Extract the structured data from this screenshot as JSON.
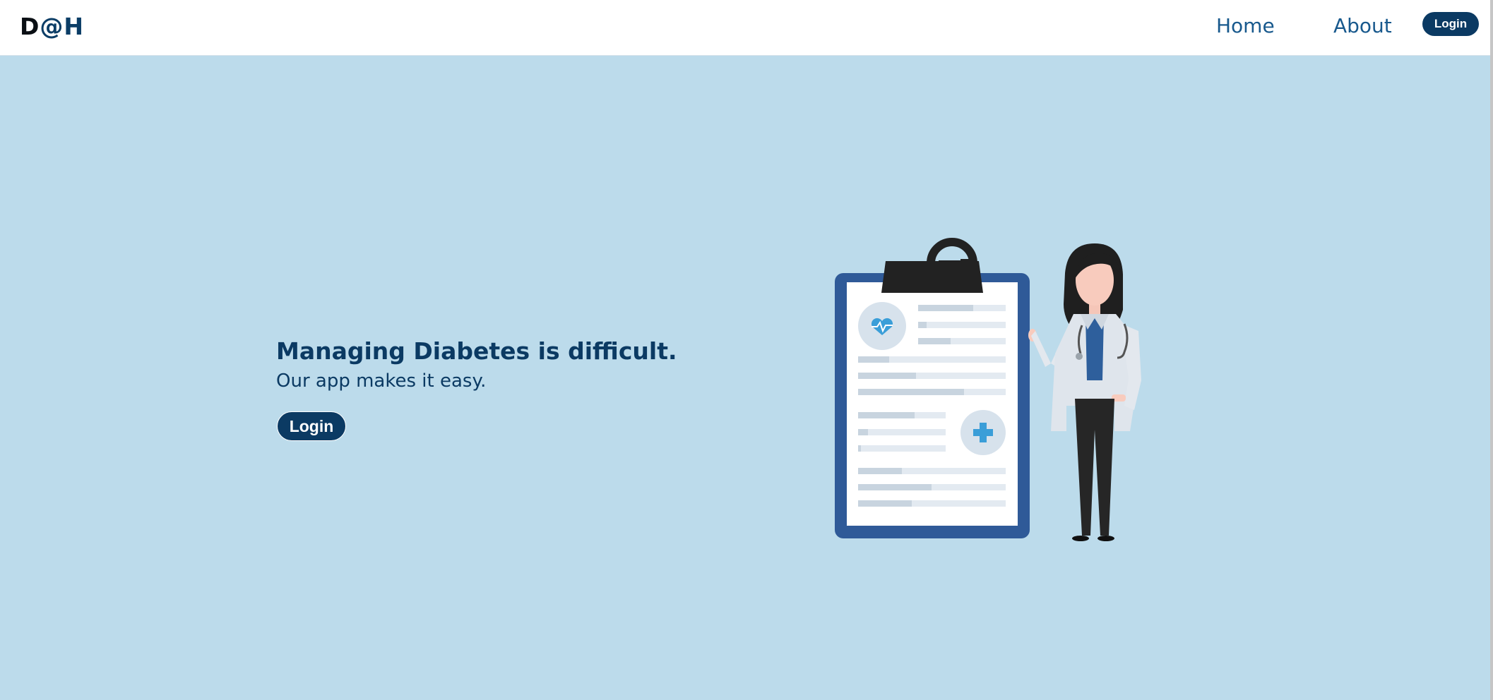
{
  "navbar": {
    "brand_prefix": "D",
    "brand_at": "@",
    "brand_suffix": "H",
    "home_label": "Home",
    "about_label": "About",
    "login_label": "Login"
  },
  "hero": {
    "headline": "Managing Diabetes is difficult.",
    "subline": "Our app makes it easy.",
    "login_label": "Login"
  },
  "colors": {
    "primary": "#0b3a63",
    "link": "#18598d",
    "hero_background": "#bcdbeb",
    "clipboard_frame": "#2f5a98"
  },
  "icons": {
    "illustration": "doctor-with-clipboard",
    "heart": "heart-pulse-icon",
    "plus": "medical-plus-icon"
  }
}
